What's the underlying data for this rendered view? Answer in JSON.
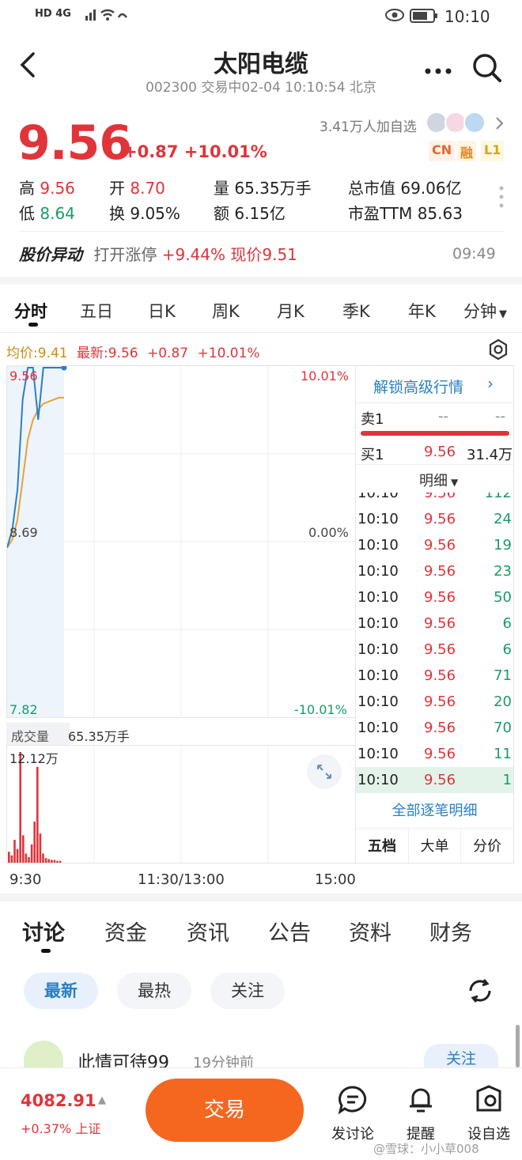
{
  "status_bar": {
    "network": "HD 4G",
    "time": "10:10"
  },
  "header": {
    "title": "太阳电缆",
    "subtitle": "002300 交易中02-04 10:10:54 北京"
  },
  "quote": {
    "price": "9.56",
    "change": "+0.87",
    "change_pct": "+10.01%",
    "followers": "3.41万人加自选",
    "tags": [
      "CN",
      "融",
      "L1"
    ],
    "stats": [
      {
        "label": "高",
        "value": "9.56"
      },
      {
        "label": "开",
        "value": "8.70"
      },
      {
        "label": "量",
        "value": "65.35万手"
      },
      {
        "label": "总市值",
        "value": "69.06亿"
      },
      {
        "label": "低",
        "value": "8.64"
      },
      {
        "label": "换",
        "value": "9.05%"
      },
      {
        "label": "额",
        "value": "6.15亿"
      },
      {
        "label": "市盈TTM",
        "value": "85.63"
      }
    ]
  },
  "alert": {
    "title": "股价异动",
    "text": "打开涨停",
    "value": "+9.44% 现价9.51",
    "time": "09:49"
  },
  "chart_tabs": [
    "分时",
    "五日",
    "日K",
    "周K",
    "月K",
    "季K",
    "年K",
    "分钟"
  ],
  "legend": {
    "avg": "均价:9.41",
    "latest": "最新:9.56",
    "chg": "+0.87",
    "pct": "+10.01%"
  },
  "chart_data": {
    "type": "line",
    "y_labels": {
      "top": "9.56",
      "mid": "8.69",
      "bottom": "7.82"
    },
    "pct_labels": {
      "top": "10.01%",
      "mid": "0.00%",
      "bottom": "-10.01%"
    },
    "x_labels": [
      "9:30",
      "11:30/13:00",
      "15:00"
    ],
    "ylim": [
      7.82,
      9.56
    ],
    "series": [
      {
        "name": "",
        "color": "#2b7fc3",
        "values": [
          8.66,
          8.75,
          8.95,
          9.4,
          9.56,
          9.56,
          9.3,
          9.56,
          9.56,
          9.56,
          9.56,
          9.56
        ]
      },
      {
        "name": "",
        "color": "#e7a23a",
        "values": [
          8.66,
          8.7,
          8.8,
          9.0,
          9.2,
          9.3,
          9.35,
          9.38,
          9.39,
          9.4,
          9.41,
          9.41
        ]
      }
    ],
    "volume_title": "成交量",
    "volume_total": "65.35万手",
    "volume_max": "12.12万",
    "volume": [
      1.2,
      0.8,
      2.5,
      1.5,
      12.12,
      3.0,
      1.0,
      0.6,
      2.0,
      4.5,
      10.5,
      3.2,
      1.0,
      0.5,
      0.4,
      0.3,
      0.3,
      0.2,
      0.2
    ]
  },
  "order_book": {
    "unlock": "解锁高级行情",
    "sell1": {
      "label": "卖1",
      "price": "--",
      "vol": "--"
    },
    "buy1": {
      "label": "买1",
      "price": "9.56",
      "vol": "31.4万"
    },
    "detail_label": "明细",
    "trades": [
      {
        "time": "10:10",
        "price": "9.56",
        "vol": "112"
      },
      {
        "time": "10:10",
        "price": "9.56",
        "vol": "24"
      },
      {
        "time": "10:10",
        "price": "9.56",
        "vol": "19"
      },
      {
        "time": "10:10",
        "price": "9.56",
        "vol": "23"
      },
      {
        "time": "10:10",
        "price": "9.56",
        "vol": "50"
      },
      {
        "time": "10:10",
        "price": "9.56",
        "vol": "6"
      },
      {
        "time": "10:10",
        "price": "9.56",
        "vol": "6"
      },
      {
        "time": "10:10",
        "price": "9.56",
        "vol": "71"
      },
      {
        "time": "10:10",
        "price": "9.56",
        "vol": "20"
      },
      {
        "time": "10:10",
        "price": "9.56",
        "vol": "70"
      },
      {
        "time": "10:10",
        "price": "9.56",
        "vol": "11"
      },
      {
        "time": "10:10",
        "price": "9.56",
        "vol": "1"
      }
    ],
    "all_detail": "全部逐笔明细",
    "sub_tabs": [
      "五档",
      "大单",
      "分价"
    ]
  },
  "bottom_tabs": [
    "讨论",
    "资金",
    "资讯",
    "公告",
    "资料",
    "财务"
  ],
  "chips": [
    "最新",
    "最热",
    "关注"
  ],
  "post": {
    "user": "此情可待99",
    "time": "19分钟前",
    "follow": "关注"
  },
  "footer": {
    "index_value": "4082.91",
    "index_change": "+0.37% 上证",
    "trade": "交易",
    "items": [
      "发讨论",
      "提醒",
      "设自选"
    ],
    "watermark": "@雪球：小小草008"
  },
  "colors": {
    "up": "#e0343a",
    "down": "#1a9b6a",
    "accent": "#2b7fc3",
    "avg": "#e7a23a",
    "trade": "#f5661f"
  }
}
